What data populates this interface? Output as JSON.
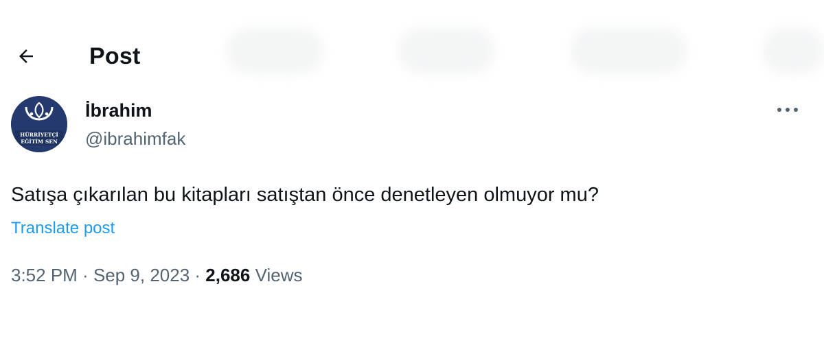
{
  "header": {
    "title": "Post",
    "back_icon": "arrow-left-icon"
  },
  "user": {
    "name": "İbrahim",
    "handle": "@ibrahimfak",
    "avatar_logo_text_top": "HÜRRİYETÇİ",
    "avatar_logo_text_bottom": "EĞİTİM SEN",
    "avatar_color": "#243a6e"
  },
  "more_icon": "more-horizontal-icon",
  "tweet": {
    "text": "Satışa çıkarılan bu kitapları satıştan önce denetleyen olmuyor mu?",
    "translate_label": "Translate post",
    "time": "3:52 PM",
    "separator": " · ",
    "date": "Sep 9, 2023",
    "views_count": "2,686",
    "views_label": " Views"
  },
  "colors": {
    "link": "#1d9bf0",
    "secondary_text": "#536471",
    "primary_text": "#0f1419"
  }
}
